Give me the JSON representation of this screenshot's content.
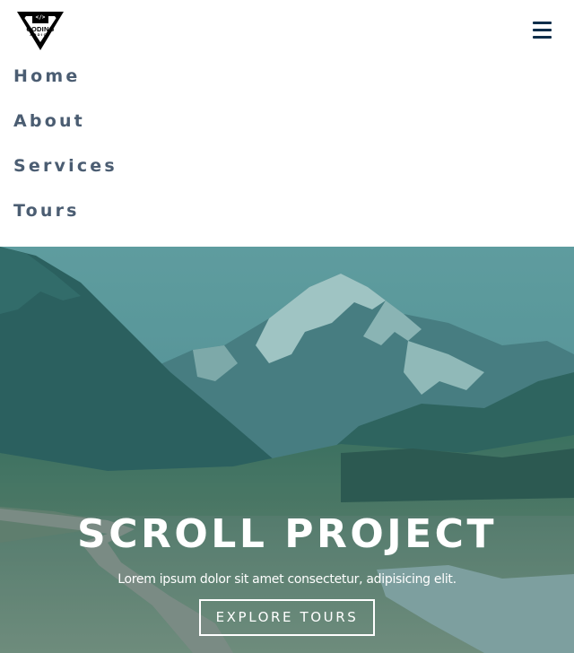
{
  "logo": {
    "code_glyph": "</>",
    "line1": "CODING",
    "line2": "ADDICT"
  },
  "nav": {
    "toggle_icon": "hamburger-icon",
    "links": [
      {
        "label": "Home"
      },
      {
        "label": "About"
      },
      {
        "label": "Services"
      },
      {
        "label": "Tours"
      }
    ]
  },
  "hero": {
    "title": "SCROLL PROJECT",
    "text": "Lorem ipsum dolor sit amet consectetur, adipisicing elit.",
    "button_label": "EXPLORE TOURS"
  },
  "colors": {
    "nav_link": "#4b5d72",
    "toggle": "#0f2e4a",
    "hero_overlay": "#2e7e80"
  }
}
